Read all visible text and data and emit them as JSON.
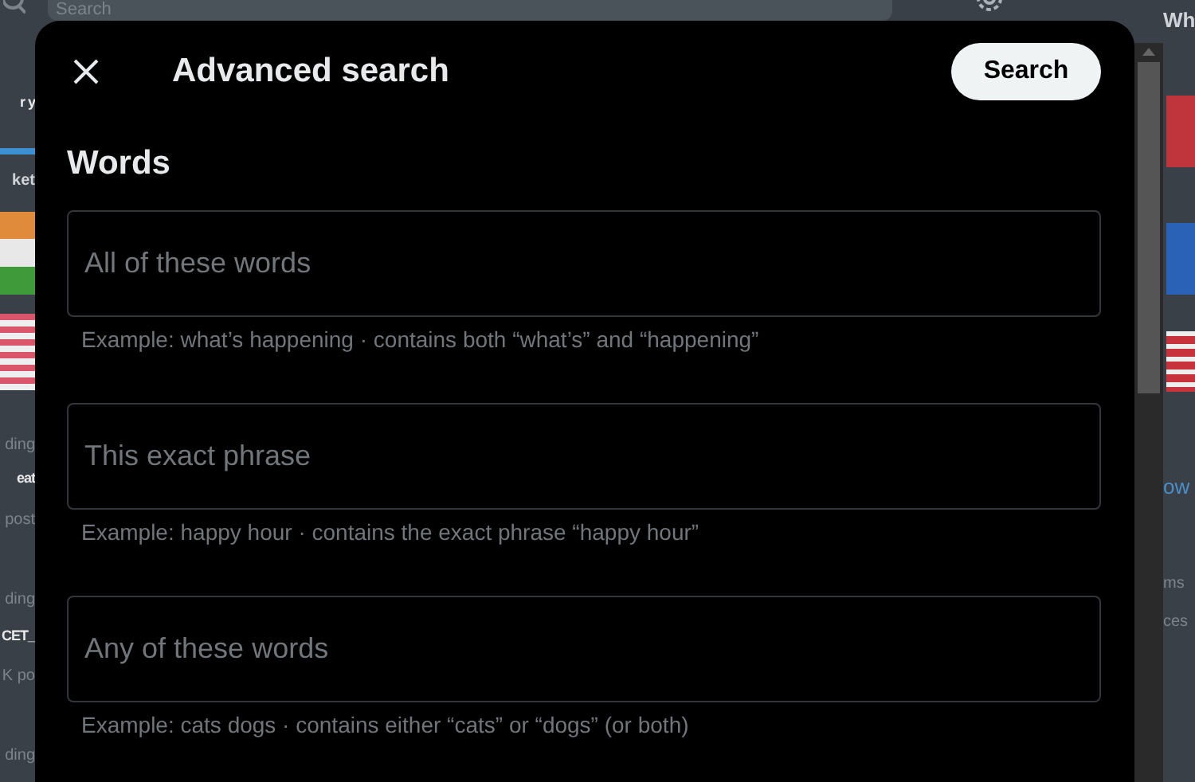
{
  "background": {
    "search": {
      "placeholder": "Search"
    },
    "left_fragments": [
      {
        "text": "r y",
        "kind": "heading"
      },
      {
        "text": "ket",
        "kind": "label"
      },
      {
        "text": "ding",
        "kind": "meta"
      },
      {
        "text": "eat",
        "kind": "heading"
      },
      {
        "text": "post",
        "kind": "meta"
      },
      {
        "text": "ding",
        "kind": "meta"
      },
      {
        "text": "CET_",
        "kind": "heading"
      },
      {
        "text": "K po",
        "kind": "meta"
      },
      {
        "text": "ding",
        "kind": "meta"
      }
    ],
    "right_fragments": [
      {
        "text": "Wh",
        "kind": "heading"
      },
      {
        "text": "ow",
        "kind": "link"
      },
      {
        "text": "ms",
        "kind": "meta"
      },
      {
        "text": "ces",
        "kind": "meta"
      }
    ]
  },
  "dialog": {
    "title": "Advanced search",
    "search_button": "Search",
    "section": "Words",
    "fields": [
      {
        "placeholder": "All of these words",
        "hint": "Example: what’s happening · contains both “what’s” and “happening”"
      },
      {
        "placeholder": "This exact phrase",
        "hint": "Example: happy hour · contains the exact phrase “happy hour”"
      },
      {
        "placeholder": "Any of these words",
        "hint": "Example: cats dogs · contains either “cats” or “dogs” (or both)"
      }
    ]
  }
}
